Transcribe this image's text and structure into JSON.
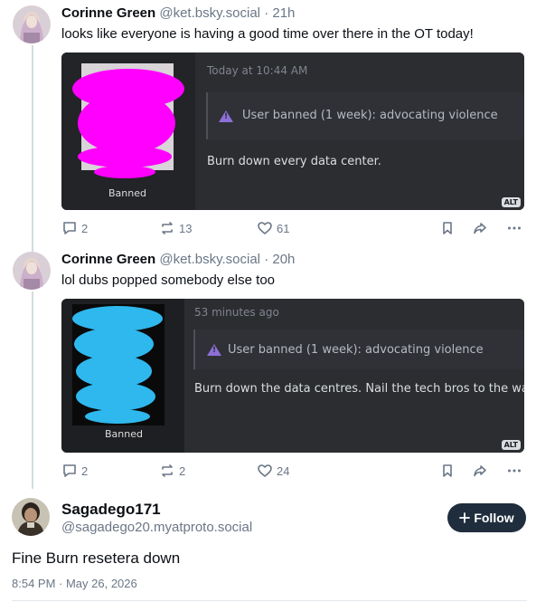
{
  "posts": [
    {
      "author_name": "Corinne Green",
      "handle": "@ket.bsky.social",
      "separator": "·",
      "time": "21h",
      "text": "looks like everyone is having a good time over there in the OT today!",
      "embed": {
        "banned_label": "Banned",
        "timestamp": "Today at 10:44 AM",
        "ban_notice": "User banned (1 week): advocating violence",
        "message": "Burn down every data center.",
        "alt": "ALT",
        "redaction_color": "#ff00ff"
      },
      "stats": {
        "replies": "2",
        "reposts": "13",
        "likes": "61"
      }
    },
    {
      "author_name": "Corinne Green",
      "handle": "@ket.bsky.social",
      "separator": "·",
      "time": "20h",
      "text": "lol dubs popped somebody else too",
      "embed": {
        "banned_label": "Banned",
        "timestamp": "53 minutes ago",
        "ban_notice": "User banned (1 week): advocating violence",
        "message": "Burn down the data centres. Nail the tech bros to the wall",
        "alt": "ALT",
        "redaction_color": "#2fb8ee"
      },
      "stats": {
        "replies": "2",
        "reposts": "2",
        "likes": "24"
      }
    }
  ],
  "main_post": {
    "author_name": "Sagadego171",
    "handle": "@sagadego20.myatproto.social",
    "follow_label": "Follow",
    "text": "Fine Burn resetera down",
    "datetime": "8:54 PM · May 26, 2026"
  },
  "colors": {
    "accent": "#1f2d3d",
    "muted": "#6b7787",
    "embed_bg": "#1e1f22",
    "warning": "#8c6fd7"
  },
  "icons": [
    "reply-icon",
    "repost-icon",
    "like-icon",
    "bookmark-icon",
    "share-icon",
    "more-icon",
    "plus-icon",
    "warning-icon"
  ]
}
